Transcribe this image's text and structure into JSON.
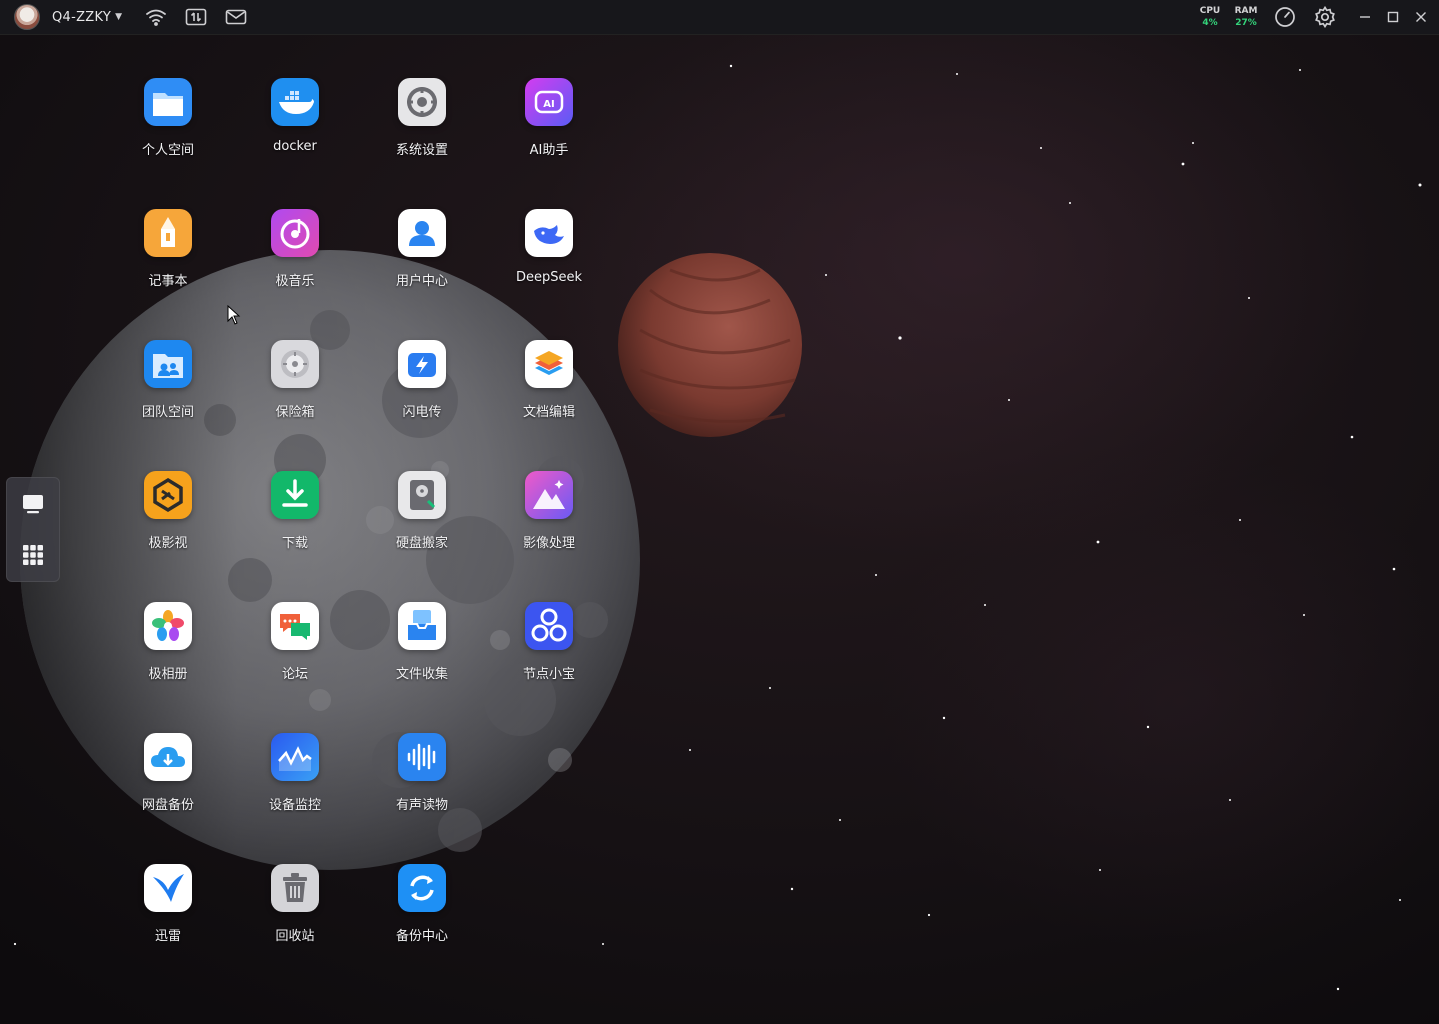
{
  "topbar": {
    "device_name": "Q4-ZZKY",
    "cpu_label": "CPU",
    "cpu_value": "4%",
    "ram_label": "RAM",
    "ram_value": "27%"
  },
  "apps": [
    {
      "label": "个人空间"
    },
    {
      "label": "docker"
    },
    {
      "label": "系统设置"
    },
    {
      "label": "AI助手"
    },
    {
      "label": "记事本"
    },
    {
      "label": "极音乐"
    },
    {
      "label": "用户中心"
    },
    {
      "label": "DeepSeek"
    },
    {
      "label": "团队空间"
    },
    {
      "label": "保险箱"
    },
    {
      "label": "闪电传"
    },
    {
      "label": "文档编辑"
    },
    {
      "label": "极影视"
    },
    {
      "label": "下载"
    },
    {
      "label": "硬盘搬家"
    },
    {
      "label": "影像处理"
    },
    {
      "label": "极相册"
    },
    {
      "label": "论坛"
    },
    {
      "label": "文件收集"
    },
    {
      "label": "节点小宝"
    },
    {
      "label": "网盘备份"
    },
    {
      "label": "设备监控"
    },
    {
      "label": "有声读物"
    },
    {
      "label": "迅雷"
    },
    {
      "label": "回收站"
    },
    {
      "label": "备份中心"
    }
  ],
  "colors": {
    "topbar_bg": "#17171b",
    "stat_value": "#34d27a",
    "dock_bg": "#3e3e46"
  }
}
